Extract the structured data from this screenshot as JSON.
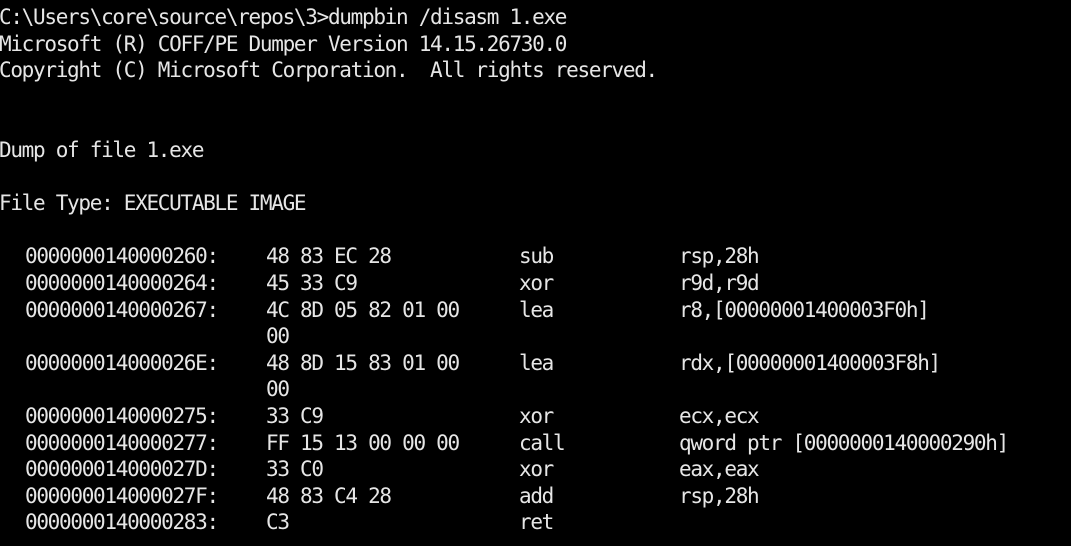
{
  "console": {
    "prompt_line": "C:\\Users\\core\\source\\repos\\3>dumpbin /disasm 1.exe",
    "version_line": "Microsoft (R) COFF/PE Dumper Version 14.15.26730.0",
    "copyright_line": "Copyright (C) Microsoft Corporation.  All rights reserved.",
    "dump_line": "Dump of file 1.exe",
    "file_type_line": "File Type: EXECUTABLE IMAGE",
    "disasm": [
      {
        "addr": "0000000140000260:",
        "bytes": "48 83 EC 28",
        "mnemonic": "sub",
        "operands": "rsp,28h"
      },
      {
        "addr": "0000000140000264:",
        "bytes": "45 33 C9",
        "mnemonic": "xor",
        "operands": "r9d,r9d"
      },
      {
        "addr": "0000000140000267:",
        "bytes": "4C 8D 05 82 01 00",
        "mnemonic": "lea",
        "operands": "r8,[00000001400003F0h]"
      },
      {
        "addr": "",
        "bytes": "00",
        "mnemonic": "",
        "operands": ""
      },
      {
        "addr": "000000014000026E:",
        "bytes": "48 8D 15 83 01 00",
        "mnemonic": "lea",
        "operands": "rdx,[00000001400003F8h]"
      },
      {
        "addr": "",
        "bytes": "00",
        "mnemonic": "",
        "operands": ""
      },
      {
        "addr": "0000000140000275:",
        "bytes": "33 C9",
        "mnemonic": "xor",
        "operands": "ecx,ecx"
      },
      {
        "addr": "0000000140000277:",
        "bytes": "FF 15 13 00 00 00",
        "mnemonic": "call",
        "operands": "qword ptr [0000000140000290h]"
      },
      {
        "addr": "000000014000027D:",
        "bytes": "33 C0",
        "mnemonic": "xor",
        "operands": "eax,eax"
      },
      {
        "addr": "000000014000027F:",
        "bytes": "48 83 C4 28",
        "mnemonic": "add",
        "operands": "rsp,28h"
      },
      {
        "addr": "0000000140000283:",
        "bytes": "C3",
        "mnemonic": "ret",
        "operands": ""
      }
    ]
  }
}
